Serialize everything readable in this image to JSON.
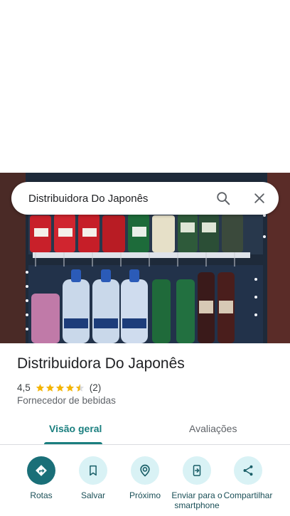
{
  "search": {
    "query": "Distribuidora Do Japonês"
  },
  "place": {
    "name": "Distribuidora Do Japonês",
    "rating": "4,5",
    "rating_stars": 4.5,
    "review_count": "(2)",
    "category": "Fornecedor de bebidas"
  },
  "tabs": [
    {
      "label": "Visão geral",
      "active": true
    },
    {
      "label": "Avaliações",
      "active": false
    }
  ],
  "actions": [
    {
      "label": "Rotas",
      "icon": "directions-icon"
    },
    {
      "label": "Salvar",
      "icon": "bookmark-icon"
    },
    {
      "label": "Próximo",
      "icon": "nearby-icon"
    },
    {
      "label": "Enviar para o smartphone",
      "icon": "send-to-phone-icon"
    },
    {
      "label": "Compartilhar",
      "icon": "share-icon"
    }
  ],
  "colors": {
    "accent": "#1a7f7f",
    "action_bg": "#d9f2f5",
    "primary_action": "#1a6f78",
    "star": "#f4b400"
  }
}
